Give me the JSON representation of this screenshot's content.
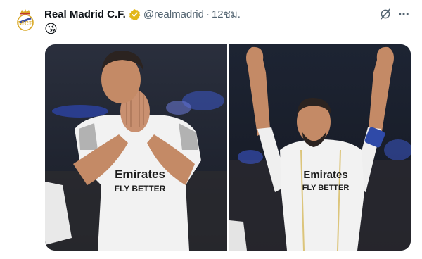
{
  "post": {
    "author_name": "Real Madrid C.F.",
    "handle": "@realmadrid",
    "separator": "·",
    "time": "12ชม.",
    "text": "😘"
  },
  "icons": {
    "avatar": "real-madrid-crest",
    "verified": "gold-verified-badge-icon",
    "grok": "grok-icon",
    "more": "more-options-icon"
  },
  "media": {
    "photos": [
      {
        "sponsor_line1": "Emirates",
        "sponsor_line2": "FLY BETTER"
      },
      {
        "sponsor_line1": "Emirates",
        "sponsor_line2": "FLY BETTER"
      }
    ]
  },
  "colors": {
    "verified_gold": "#e2b719",
    "text_secondary": "#536471",
    "stadium_dark": "#1b2230",
    "kit_white": "#f2f2f2",
    "skin": "#c48a66"
  }
}
